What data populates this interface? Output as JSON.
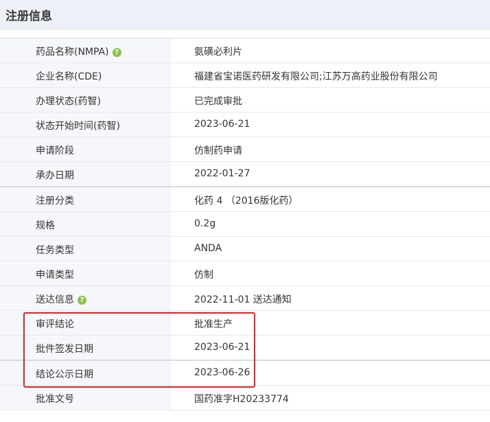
{
  "header": {
    "title": "注册信息"
  },
  "rows": [
    {
      "label": "药品名称(NMPA)",
      "value": "氨磺必利片",
      "help": true
    },
    {
      "label": "企业名称(CDE)",
      "value": "福建省宝诺医药研发有限公司;江苏万高药业股份有限公司"
    },
    {
      "label": "办理状态(药智)",
      "value": "已完成审批"
    },
    {
      "label": "状态开始时间(药智)",
      "value": "2023-06-21"
    },
    {
      "label": "申请阶段",
      "value": "仿制药申请"
    },
    {
      "label": "承办日期",
      "value": "2022-01-27"
    },
    {
      "label": "注册分类",
      "value": "化药 4 （2016版化药）"
    },
    {
      "label": "规格",
      "value": "0.2g"
    },
    {
      "label": "任务类型",
      "value": "ANDA"
    },
    {
      "label": "申请类型",
      "value": "仿制"
    },
    {
      "label": "送达信息",
      "value": "2022-11-01 送达通知",
      "help": true
    },
    {
      "label": "审评结论",
      "value": "批准生产"
    },
    {
      "label": "批件签发日期",
      "value": "2023-06-21"
    },
    {
      "label": "结论公示日期",
      "value": "2023-06-26"
    },
    {
      "label": "批准文号",
      "value": "国药准字H20233774"
    }
  ],
  "help_icon_glyph": "?",
  "colors": {
    "highlight": "#e02020",
    "help_icon": "#8bc34a",
    "label_bg": "#f5f7fa",
    "header_bg": "#eef0f8"
  }
}
